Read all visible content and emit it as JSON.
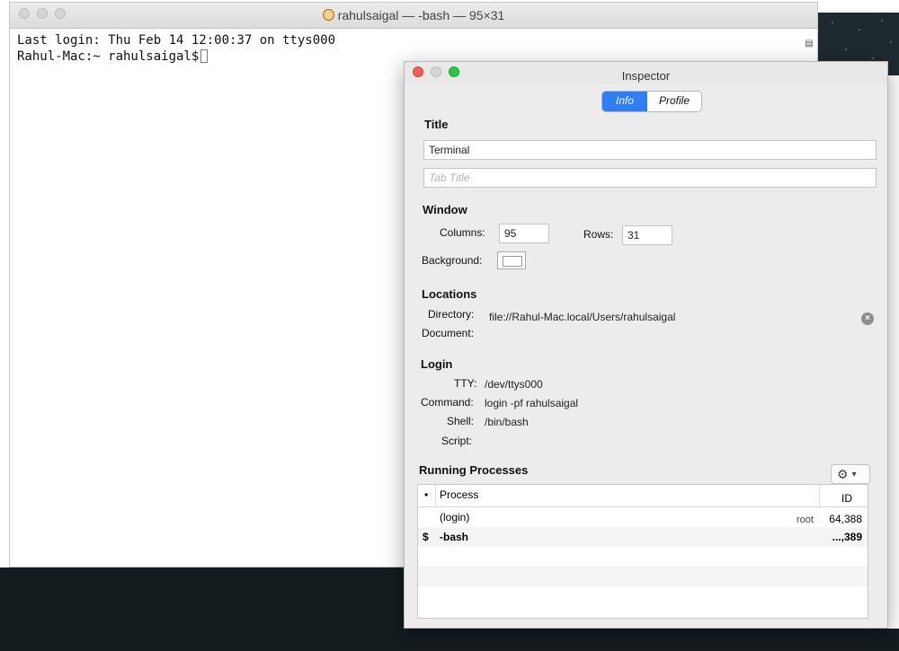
{
  "terminal": {
    "title": "rahulsaigal — -bash — 95×31",
    "lines": [
      "Last login: Thu Feb 14 12:00:37 on ttys000",
      "Rahul-Mac:~ rahulsaigal$"
    ]
  },
  "inspector": {
    "title": "Inspector",
    "tabs": [
      "Info",
      "Profile"
    ],
    "active_tab": "Info",
    "title_section": {
      "heading": "Title",
      "title_value": "Terminal",
      "tab_title_placeholder": "Tab Title"
    },
    "window_section": {
      "heading": "Window",
      "columns_label": "Columns:",
      "columns_value": "95",
      "rows_label": "Rows:",
      "rows_value": "31",
      "background_label": "Background:"
    },
    "locations_section": {
      "heading": "Locations",
      "directory_label": "Directory:",
      "directory_value": "file://Rahul-Mac.local/Users/rahulsaigal",
      "document_label": "Document:"
    },
    "login_section": {
      "heading": "Login",
      "tty_label": "TTY:",
      "tty_value": "/dev/ttys000",
      "command_label": "Command:",
      "command_value": "login -pf rahulsaigal",
      "shell_label": "Shell:",
      "shell_value": "/bin/bash",
      "script_label": "Script:"
    },
    "processes_section": {
      "heading": "Running Processes",
      "columns": [
        "•",
        "Process",
        "ID"
      ],
      "rows": [
        {
          "marker": "",
          "process": "(login)",
          "user": "root",
          "id": "64,388"
        },
        {
          "marker": "$",
          "process": "-bash",
          "user": "",
          "id": "...,389"
        }
      ]
    }
  },
  "colors": {
    "accent": "#2f7ef6",
    "close": "#fc5f57",
    "minimize": "#fdbc2e",
    "zoom": "#28c840"
  }
}
